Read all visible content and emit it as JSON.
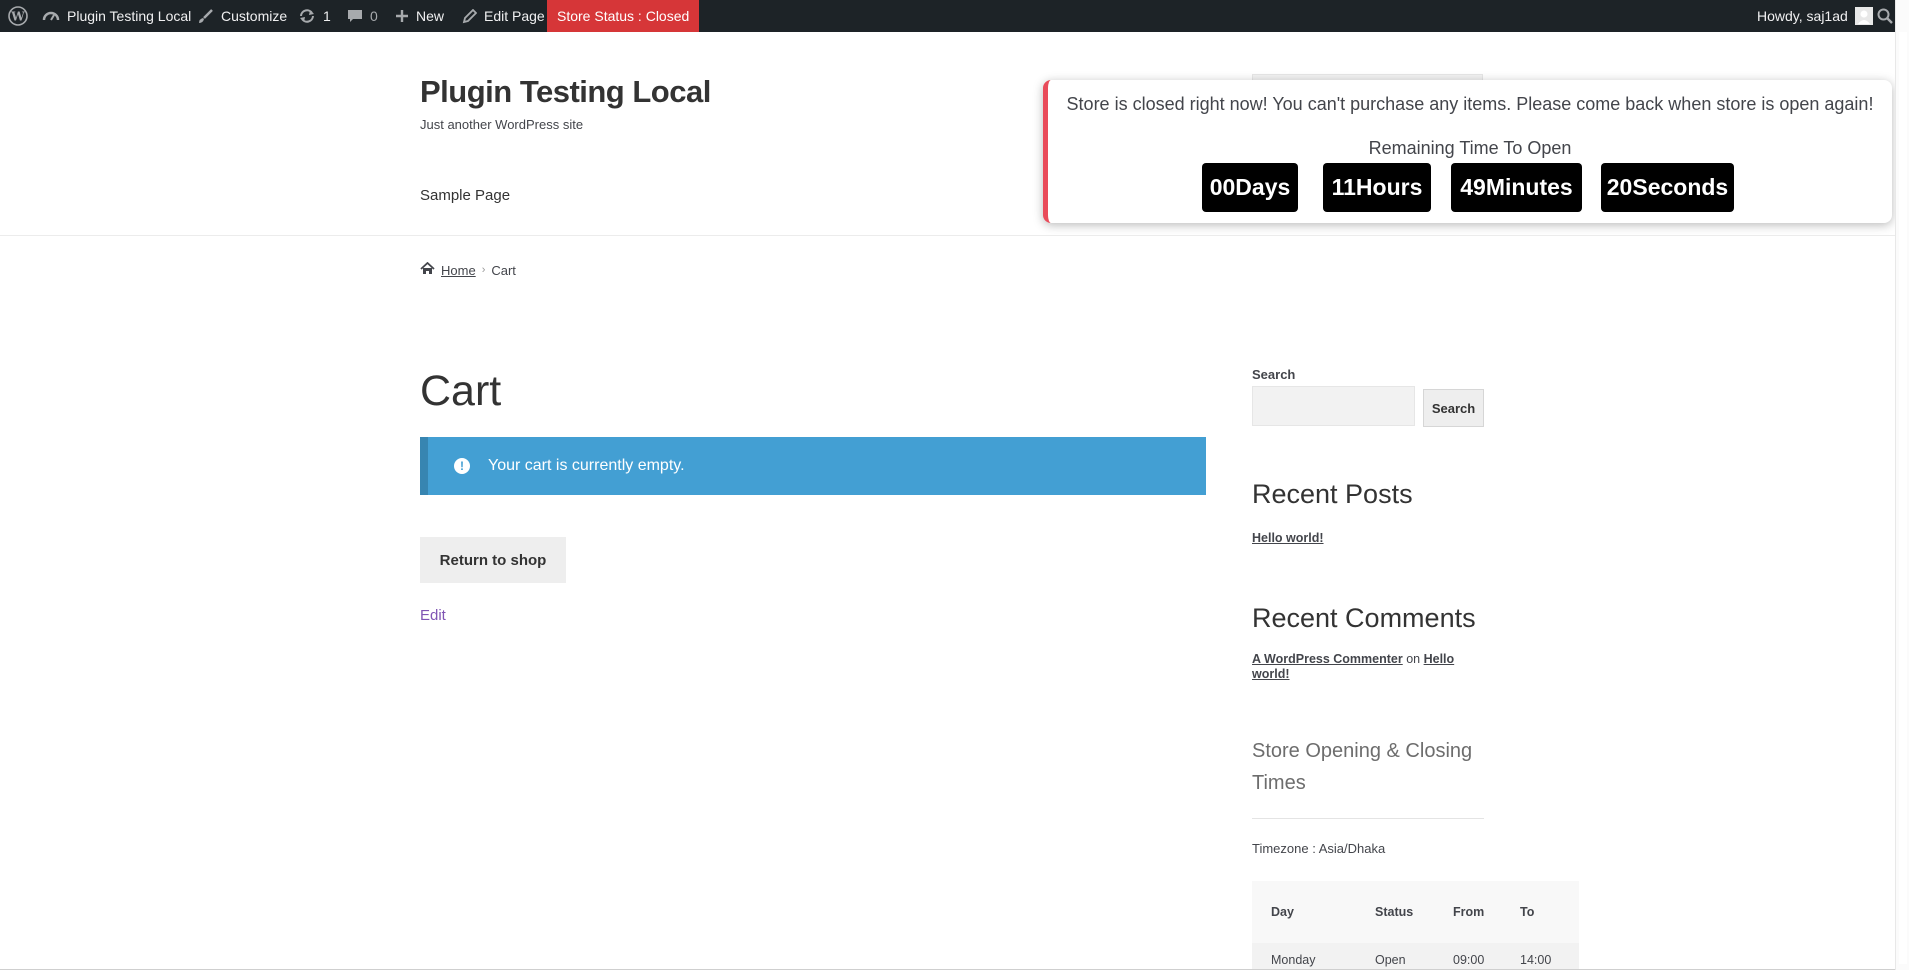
{
  "admin_bar": {
    "site_name": "Plugin Testing Local",
    "customize": "Customize",
    "updates_count": "1",
    "comments_count": "0",
    "new_label": "New",
    "edit_page": "Edit Page",
    "store_status": "Store Status : Closed",
    "greeting": "Howdy, saj1ad",
    "icons": [
      "wordpress-logo-icon",
      "dashboard-icon",
      "brush-icon",
      "updates-icon",
      "comment-icon",
      "plus-icon",
      "pencil-icon",
      "avatar-icon",
      "search-icon"
    ],
    "colors": {
      "background": "#1d2327",
      "store_status_bg": "#d63638"
    }
  },
  "header": {
    "site_title": "Plugin Testing Local",
    "tagline": "Just another WordPress site",
    "nav": [
      "Sample Page"
    ]
  },
  "popup": {
    "message": "Store is closed right now! You can't purchase any items. Please come back when store is open again!",
    "remaining_label": "Remaining Time To Open",
    "countdown": [
      "00Days",
      "11Hours",
      "49Minutes",
      "20Seconds"
    ],
    "accent_color": "#e94b5a"
  },
  "breadcrumb": {
    "home": "Home",
    "current": "Cart"
  },
  "main": {
    "title": "Cart",
    "notice": "Your cart is currently empty.",
    "notice_color": "#439fd3",
    "return_button": "Return to shop",
    "edit_link": "Edit"
  },
  "sidebar": {
    "search_label": "Search",
    "search_button": "Search",
    "recent_posts_title": "Recent Posts",
    "recent_posts": [
      "Hello world!"
    ],
    "recent_comments_title": "Recent Comments",
    "comment": {
      "author": "A WordPress Commenter",
      "on": "on",
      "post": "Hello world!"
    },
    "store_times_title": "Store Opening & Closing Times",
    "timezone": "Timezone : Asia/Dhaka",
    "table": {
      "headers": [
        "Day",
        "Status",
        "From",
        "To"
      ],
      "rows": [
        [
          "Monday",
          "Open",
          "09:00",
          "14:00"
        ]
      ]
    }
  }
}
